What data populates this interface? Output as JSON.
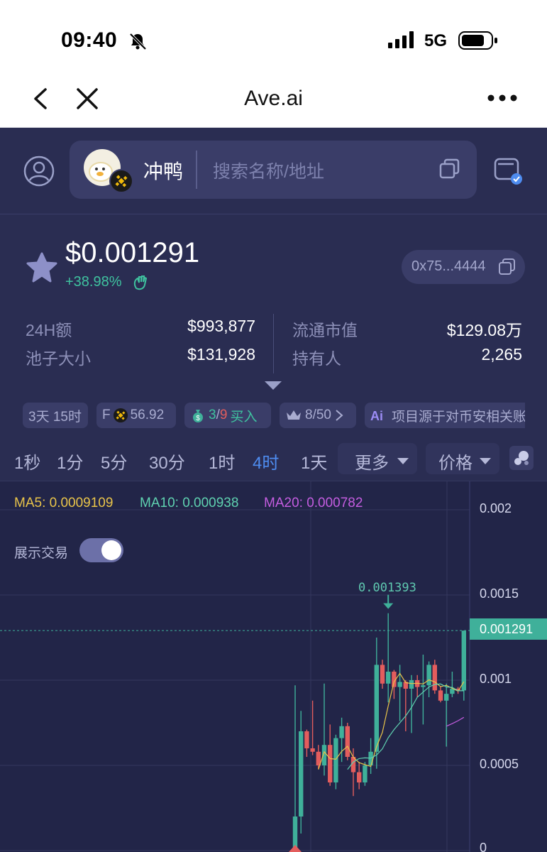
{
  "status_bar": {
    "time": "09:40",
    "network": "5G"
  },
  "browser": {
    "title": "Ave.ai"
  },
  "search": {
    "token_name": "冲鸭",
    "placeholder": "搜索名称/地址"
  },
  "token": {
    "price": "$0.001291",
    "change": "+38.98%",
    "address": "0x75...4444",
    "stats": [
      {
        "label": "24H额",
        "value": "$993,877"
      },
      {
        "label": "池子大小",
        "value": "$131,928"
      },
      {
        "label": "流通市值",
        "value": "$129.08万"
      },
      {
        "label": "持有人",
        "value": "2,265"
      }
    ],
    "chips": {
      "age": "3天 15时",
      "f_prefix": "F",
      "f_value": "56.92",
      "buy_count": "3",
      "buy_sep": "/",
      "buy_total": "9",
      "buy_label": "买入",
      "top": "8/50",
      "ai_text": "项目源于对币安相关账"
    }
  },
  "tabs": {
    "items": [
      "1秒",
      "1分",
      "5分",
      "30分",
      "1时",
      "4时",
      "1天"
    ],
    "active": "4时",
    "more": "更多",
    "price": "价格"
  },
  "chart": {
    "ma5": "MA5: 0.0009109",
    "ma10": "MA10: 0.000938",
    "ma20": "MA20: 0.000782",
    "toggle_label": "展示交易",
    "toggle_on": true,
    "high_label": "0.001393",
    "current_price_label": "0.001291",
    "y_ticks": [
      "0.002",
      "0.0015",
      "0.001",
      "0.0005",
      "0"
    ]
  },
  "colors": {
    "up": "#3fb09a",
    "down": "#e35d5d",
    "ma5": "#e9c44a",
    "ma10": "#5fd1b0",
    "ma20": "#c45de0",
    "accent": "#4e8cf0"
  },
  "chart_data": {
    "type": "candlestick",
    "interval": "4时",
    "y_ticks": [
      0.002,
      0.0015,
      0.001,
      0.0005,
      0
    ],
    "ylim": [
      0,
      0.002
    ],
    "current_price": 0.001291,
    "highest_marked": 0.001393,
    "candles": [
      {
        "o": 1e-05,
        "h": 0.00097,
        "l": 5e-06,
        "c": 0.0002
      },
      {
        "o": 0.0002,
        "h": 0.00082,
        "l": 0.0001,
        "c": 0.0007
      },
      {
        "o": 0.0007,
        "h": 0.00071,
        "l": 0.00055,
        "c": 0.0006
      },
      {
        "o": 0.0006,
        "h": 0.00088,
        "l": 0.00056,
        "c": 0.00058
      },
      {
        "o": 0.00058,
        "h": 0.00062,
        "l": 0.00048,
        "c": 0.0005
      },
      {
        "o": 0.0005,
        "h": 0.00098,
        "l": 0.00044,
        "c": 0.00062
      },
      {
        "o": 0.00062,
        "h": 0.00074,
        "l": 0.00038,
        "c": 0.0004
      },
      {
        "o": 0.0004,
        "h": 0.00068,
        "l": 0.00036,
        "c": 0.00066
      },
      {
        "o": 0.00066,
        "h": 0.00078,
        "l": 0.00052,
        "c": 0.00073
      },
      {
        "o": 0.00073,
        "h": 0.00075,
        "l": 0.00053,
        "c": 0.00055
      },
      {
        "o": 0.00055,
        "h": 0.0006,
        "l": 0.00032,
        "c": 0.00046
      },
      {
        "o": 0.00046,
        "h": 0.00052,
        "l": 0.00036,
        "c": 0.0004
      },
      {
        "o": 0.0004,
        "h": 0.00052,
        "l": 0.00038,
        "c": 0.0005
      },
      {
        "o": 0.0005,
        "h": 0.00066,
        "l": 0.00045,
        "c": 0.00058
      },
      {
        "o": 0.00058,
        "h": 0.00125,
        "l": 0.00048,
        "c": 0.00109
      },
      {
        "o": 0.00109,
        "h": 0.00112,
        "l": 0.00095,
        "c": 0.00098
      },
      {
        "o": 0.00098,
        "h": 0.001393,
        "l": 0.00087,
        "c": 0.00105
      },
      {
        "o": 0.00105,
        "h": 0.00106,
        "l": 0.00089,
        "c": 0.00096
      },
      {
        "o": 0.00096,
        "h": 0.00109,
        "l": 0.00076,
        "c": 0.00099
      },
      {
        "o": 0.00099,
        "h": 0.001,
        "l": 0.0007,
        "c": 0.00095
      },
      {
        "o": 0.00095,
        "h": 0.00103,
        "l": 0.00069,
        "c": 0.001
      },
      {
        "o": 0.001,
        "h": 0.00103,
        "l": 0.0009,
        "c": 0.00096
      },
      {
        "o": 0.00096,
        "h": 0.00115,
        "l": 0.00074,
        "c": 0.00097
      },
      {
        "o": 0.00097,
        "h": 0.00111,
        "l": 0.0009,
        "c": 0.00109
      },
      {
        "o": 0.00109,
        "h": 0.00112,
        "l": 0.00092,
        "c": 0.00094
      },
      {
        "o": 0.00094,
        "h": 0.00096,
        "l": 0.00087,
        "c": 0.00088
      },
      {
        "o": 0.00088,
        "h": 0.00098,
        "l": 0.00061,
        "c": 0.00092
      },
      {
        "o": 0.00092,
        "h": 0.00105,
        "l": 0.0009,
        "c": 0.00095
      },
      {
        "o": 0.00095,
        "h": 0.00096,
        "l": 0.00092,
        "c": 0.00094
      },
      {
        "o": 0.00094,
        "h": 0.001291,
        "l": 0.00088,
        "c": 0.001291
      }
    ],
    "ma5_values": [
      null,
      null,
      null,
      null,
      0.000476,
      0.00058,
      0.00054,
      0.000536,
      0.000582,
      0.000612,
      0.000548,
      0.000516,
      0.000504,
      0.000494,
      0.00061,
      0.000694,
      0.000849,
      0.000991,
      0.00104,
      0.000986,
      0.00098,
      0.000982,
      0.000978,
      0.001002,
      0.00099,
      0.000962,
      0.00097,
      0.000952,
      0.000936,
      0.000991
    ],
    "ma10_values": [
      null,
      null,
      null,
      null,
      null,
      null,
      null,
      null,
      null,
      0.000476,
      0.00052,
      0.00054,
      0.000544,
      0.000542,
      0.000561,
      0.000597,
      0.000662,
      0.00071,
      0.00075,
      0.00079,
      0.00084,
      0.0009,
      0.00093,
      0.00096,
      0.000975,
      0.000978,
      0.00096,
      0.000958,
      0.000938,
      0.000938
    ],
    "ma20_values": [
      null,
      null,
      null,
      null,
      null,
      null,
      null,
      null,
      null,
      null,
      null,
      null,
      null,
      null,
      null,
      null,
      null,
      null,
      null,
      null,
      null,
      null,
      null,
      null,
      null,
      null,
      0.00073,
      0.000745,
      0.000762,
      0.000782
    ]
  }
}
